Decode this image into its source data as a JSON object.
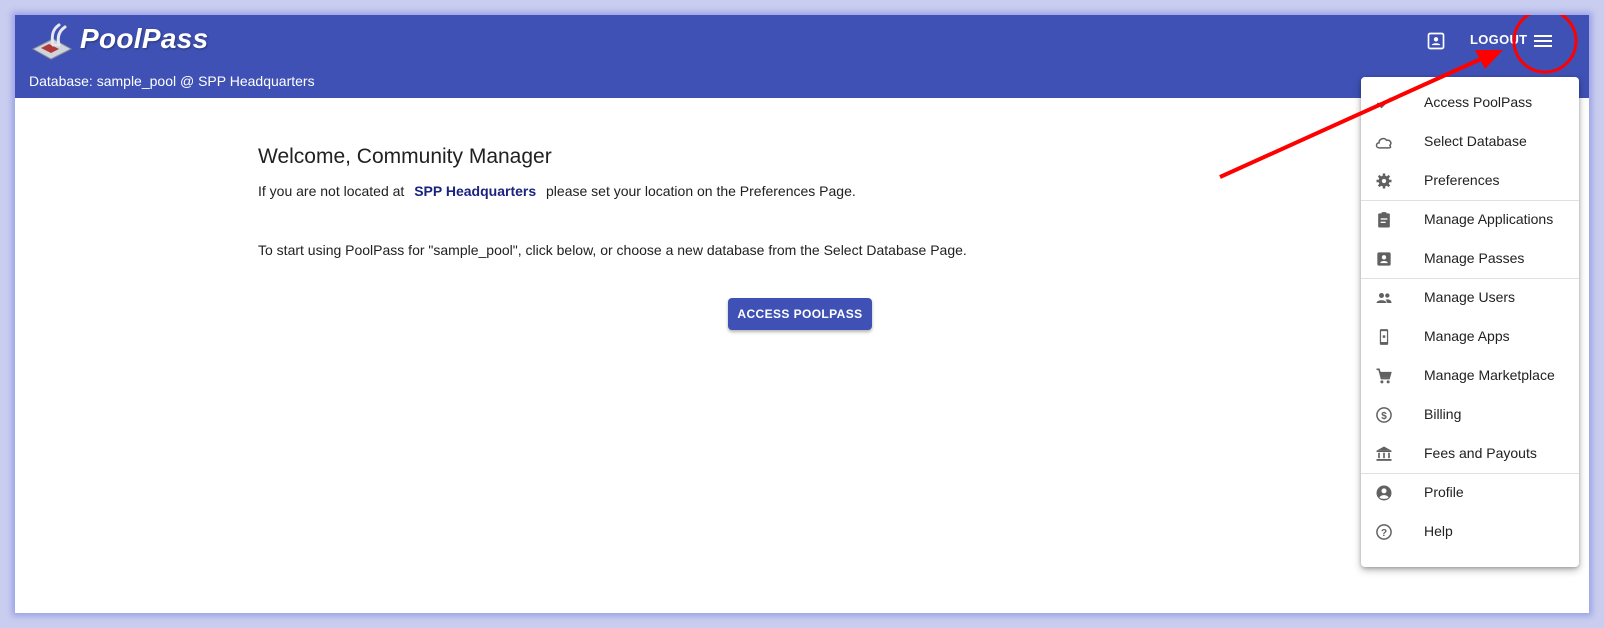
{
  "app": {
    "brand": "PoolPass",
    "database_label": "Database: sample_pool @ SPP Headquarters"
  },
  "header": {
    "logout_label": "LOGOUT"
  },
  "main": {
    "welcome": "Welcome, Community Manager",
    "location_prefix": "If you are not located at",
    "location_link": "SPP Headquarters",
    "location_suffix": "please set your location on the Preferences Page.",
    "start_text": "To start using PoolPass for \"sample_pool\", click below, or choose a new database from the Select Database Page.",
    "access_button": "ACCESS POOLPASS"
  },
  "menu": {
    "items": [
      {
        "label": "Access PoolPass",
        "icon": "check-icon"
      },
      {
        "label": "Select Database",
        "icon": "cloud-icon"
      },
      {
        "label": "Preferences",
        "icon": "gear-icon"
      },
      {
        "label": "Manage Applications",
        "icon": "clipboard-icon"
      },
      {
        "label": "Manage Passes",
        "icon": "badge-icon"
      },
      {
        "label": "Manage Users",
        "icon": "people-icon"
      },
      {
        "label": "Manage Apps",
        "icon": "phone-icon"
      },
      {
        "label": "Manage Marketplace",
        "icon": "cart-icon"
      },
      {
        "label": "Billing",
        "icon": "dollar-icon"
      },
      {
        "label": "Fees and Payouts",
        "icon": "bank-icon"
      },
      {
        "label": "Profile",
        "icon": "account-icon"
      },
      {
        "label": "Help",
        "icon": "help-icon"
      }
    ]
  },
  "colors": {
    "primary": "#3f51b5",
    "link": "#1a237e",
    "annotation": "#ff0000"
  }
}
